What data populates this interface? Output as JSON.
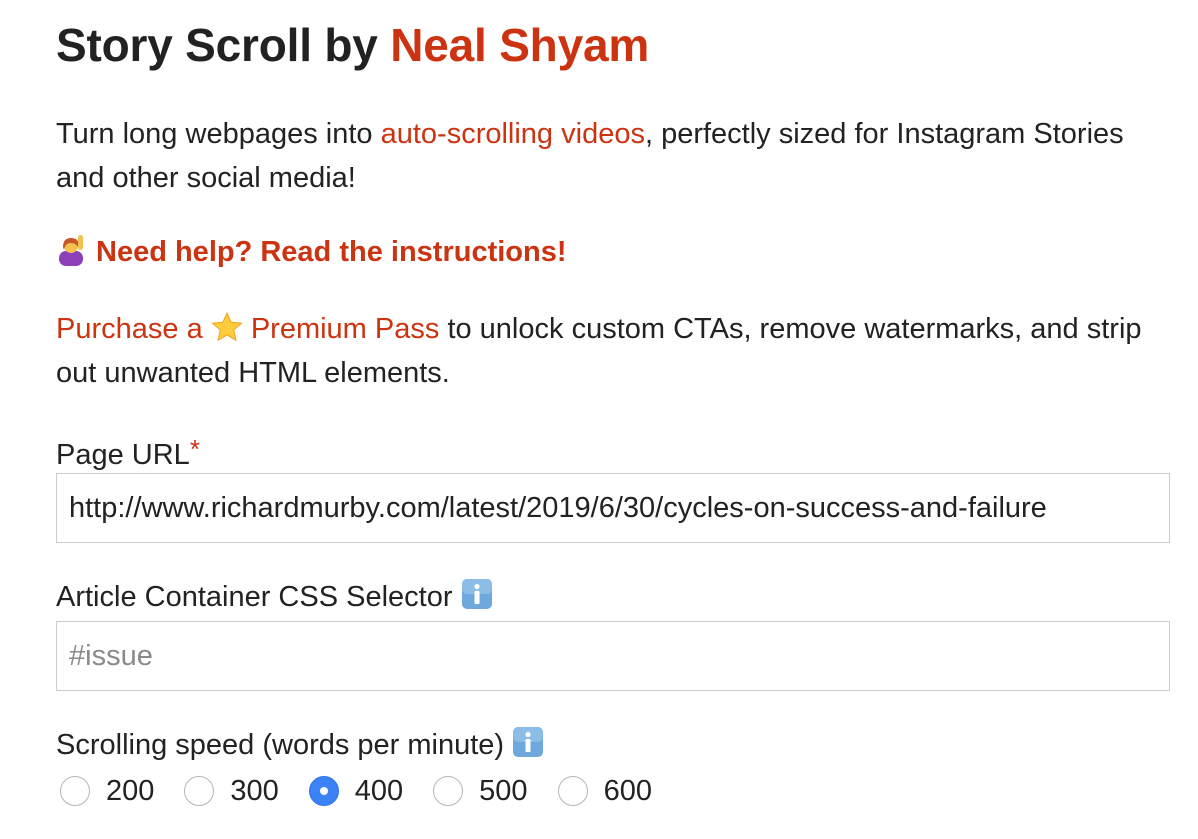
{
  "header": {
    "title_prefix": "Story Scroll by",
    "title_author": "Neal Shyam"
  },
  "intro": {
    "text_before": "Turn long webpages into",
    "link_text": "auto-scrolling videos",
    "text_after": ", perfectly sized for Instagram Stories and other social media!"
  },
  "help": {
    "icon": "person-raising-hand-emoji",
    "text": "Need help? Read the instructions!"
  },
  "premium": {
    "link_text_before": "Purchase a",
    "star_icon": "star-emoji",
    "link_text_after": "Premium Pass",
    "text": "to unlock custom CTAs, remove watermarks, and strip out unwanted HTML elements."
  },
  "form": {
    "page_url": {
      "label": "Page URL",
      "required_mark": "*",
      "value": "http://www.richardmurby.com/latest/2019/6/30/cycles-on-success-and-failure"
    },
    "selector": {
      "label": "Article Container CSS Selector",
      "info_icon": "info-icon",
      "placeholder": "#issue",
      "value": ""
    },
    "speed": {
      "label": "Scrolling speed (words per minute)",
      "info_icon": "info-icon",
      "options": [
        "200",
        "300",
        "400",
        "500",
        "600"
      ],
      "selected": "400"
    }
  },
  "colors": {
    "accent": "#cc3311",
    "text": "#222222",
    "radio_selected": "#3b82f6",
    "info_icon_bg": "#6fa8dc"
  }
}
